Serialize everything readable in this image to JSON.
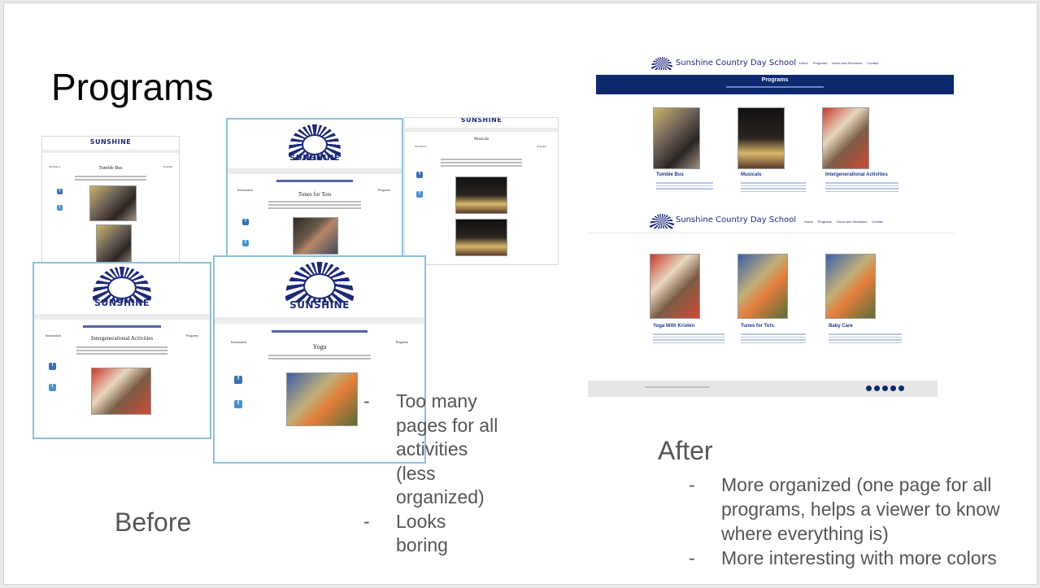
{
  "slide": {
    "title": "Programs",
    "before_label": "Before",
    "after_label": "After",
    "before_points": [
      "Too many pages for all activities (less organized)",
      "Looks boring"
    ],
    "after_points": [
      "More organized (one page for all programs, helps a viewer to know where everything is)",
      "More interesting with more colors"
    ]
  },
  "before_shots": {
    "logo": "SUNSHINE",
    "shot1": {
      "heading": "Tumble Bus"
    },
    "shot2": {
      "heading": "Tunes for Tots"
    },
    "shot3": {
      "heading": "Musicals"
    },
    "shot4": {
      "heading": "Intergenerational Activities"
    },
    "shot5": {
      "heading": "Yoga"
    },
    "side_left": "Information",
    "side_right": "Programs"
  },
  "after_shot": {
    "site_name": "Sunshine Country Day School",
    "nav": [
      "Home",
      "Programs",
      "Hours and Directions",
      "Contact"
    ],
    "banner_title": "Programs",
    "cards_top": [
      "Tumble Bus",
      "Musicals",
      "Intergenerational Activities"
    ],
    "cards_bottom": [
      "Yoga With Kristen",
      "Tunes for Tots",
      "Baby Care"
    ]
  },
  "colors": {
    "navy": "#0d2a6e",
    "text_gray": "#555555",
    "logo_blue": "#1d2a7a"
  }
}
